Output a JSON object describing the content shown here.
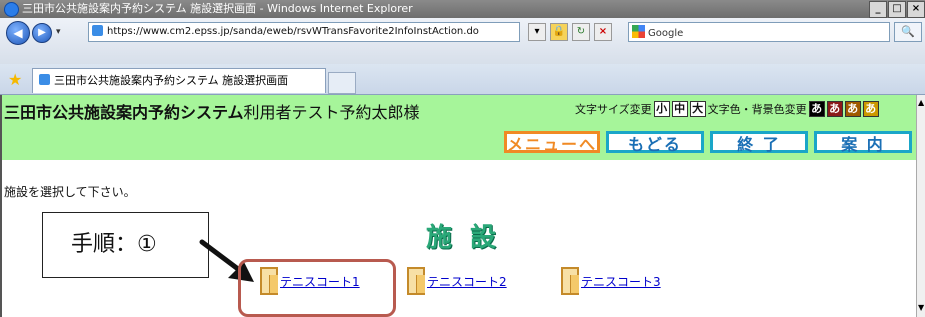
{
  "window": {
    "title": "三田市公共施設案内予約システム 施設選択画面 - Windows Internet Explorer",
    "controls": {
      "minimize": "_",
      "maximize": "□",
      "close": "×"
    }
  },
  "nav": {
    "back_label": "◀",
    "forward_label": "▶",
    "address": "https://www.cm2.epss.jp/sanda/eweb/rsvWTransFavorite2InfoInstAction.do",
    "search_placeholder": "Google",
    "search_button": "🔍"
  },
  "tab": {
    "label": "三田市公共施設案内予約システム 施設選択画面"
  },
  "page": {
    "system_title": "三田市公共施設案内予約システム",
    "user_greeting": "利用者テスト予約太郎様",
    "font_size_label": "文字サイズ変更",
    "font_sizes": [
      "小",
      "中",
      "大"
    ],
    "color_label": "文字色・背景色変更",
    "color_options": [
      "あ",
      "あ",
      "あ",
      "あ"
    ],
    "menu_buttons": {
      "menu": "メニューへ",
      "back": "もどる",
      "exit": "終 了",
      "guide": "案 内"
    },
    "instruction": "施設を選択して下さい。",
    "heading": "施設",
    "facilities": [
      {
        "name": "テニスコート1"
      },
      {
        "name": "テニスコート2"
      },
      {
        "name": "テニスコート3"
      }
    ]
  },
  "annotation": {
    "step_label": "手順：①"
  },
  "colors": {
    "header_bg": "#a6f59a",
    "menu_orange": "#f08a24",
    "menu_blue": "#1aa6c8",
    "heading_green": "#2aa878",
    "highlight_red": "#b85a4f",
    "color_option_bgs": [
      "#000000",
      "#8b1a1a",
      "#a05a00",
      "#cc9900"
    ]
  }
}
